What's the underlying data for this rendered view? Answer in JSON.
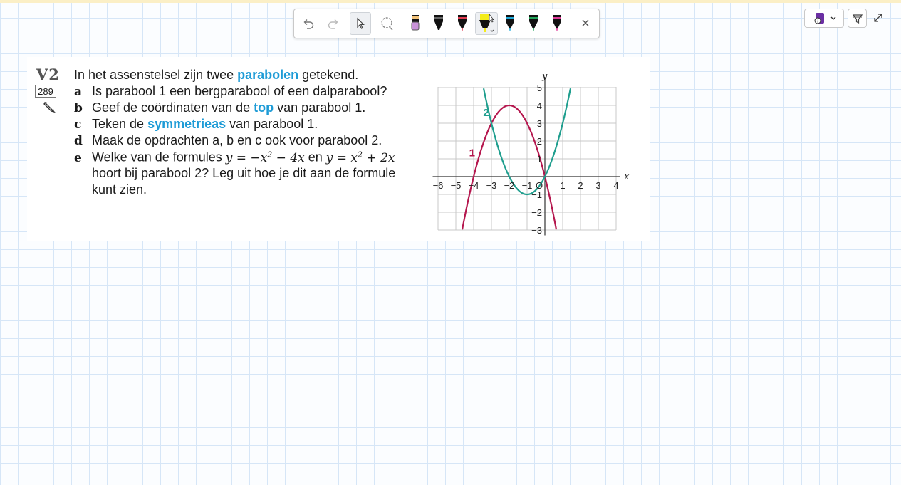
{
  "toolbar": {
    "tools": [
      "undo-icon",
      "redo-icon",
      "pointer-icon",
      "lasso-icon",
      "eraser-marker-icon",
      "black-pen-icon",
      "red-pen-icon",
      "yellow-highlighter-icon",
      "blue-pen-icon",
      "green-pen-icon",
      "pink-pen-icon"
    ],
    "close_label": "×"
  },
  "exercise": {
    "id": "V2",
    "number": "289",
    "intro_before": "In het assenstelsel zijn twee ",
    "intro_highlight": "parabolen",
    "intro_after": " getekend.",
    "questions": {
      "a": {
        "letter": "a",
        "text": "Is parabool 1 een bergparabool of een dalparabool?"
      },
      "b": {
        "letter": "b",
        "before": "Geef de coördinaten van de ",
        "highlight": "top",
        "after": " van parabool 1."
      },
      "c": {
        "letter": "c",
        "before": "Teken de ",
        "highlight": "symmetrieas",
        "after": " van parabool 1."
      },
      "d": {
        "letter": "d",
        "text": "Maak de opdrachten a, b en c ook voor parabool 2."
      },
      "e": {
        "letter": "e",
        "part1": "Welke van de formules ",
        "formula1": "y = −x",
        "exp1": "2",
        "formula1b": " − 4x",
        "mid": " en ",
        "formula2": "y = x",
        "exp2": "2",
        "formula2b": " + 2x",
        "line2": "hoort bij parabool 2? Leg uit hoe je dit aan de formule",
        "line3": "kunt zien."
      }
    }
  },
  "chart_data": {
    "type": "line",
    "xlabel": "x",
    "ylabel": "y",
    "xlim": [
      -6,
      4
    ],
    "ylim": [
      -3,
      5
    ],
    "xticks": [
      "−6",
      "−5",
      "−4",
      "−3",
      "−2",
      "−1",
      "O",
      "1",
      "2",
      "3",
      "4"
    ],
    "yticks": [
      "5",
      "4",
      "3",
      "2",
      "1",
      "−1",
      "−2",
      "−3"
    ],
    "grid": true,
    "series": [
      {
        "name": "1",
        "formula": "y = -x^2 - 4x",
        "color": "#b5174e"
      },
      {
        "name": "2",
        "formula": "y = x^2 + 2x",
        "color": "#1f9e8e"
      }
    ]
  }
}
